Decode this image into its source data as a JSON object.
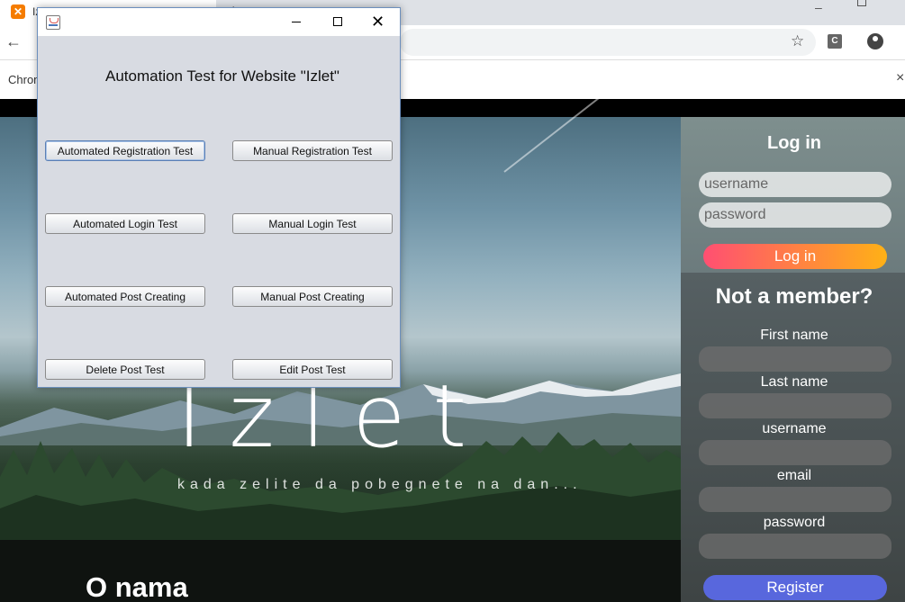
{
  "browser": {
    "tab": {
      "favicon": "xampp-icon",
      "title": "Iz",
      "close": "×"
    },
    "new_tab": "+",
    "window_minimize": "–",
    "toolbar": {
      "back": "←",
      "star": "☆",
      "extension_label": "C",
      "menu": "⋮"
    },
    "infobar": {
      "text": "Chrom",
      "close": "×"
    }
  },
  "site": {
    "brand": "Izlet",
    "tagline": "kada zelite da pobegnete na dan...",
    "about_title": "O nama",
    "login": {
      "title": "Log in",
      "username_placeholder": "username",
      "password_placeholder": "password",
      "button": "Log in"
    },
    "register": {
      "title": "Not a member?",
      "labels": {
        "first_name": "First name",
        "last_name": "Last name",
        "username": "username",
        "email": "email",
        "password": "password"
      },
      "button": "Register"
    },
    "colors": {
      "login_gradient_start": "#ff4f72",
      "login_gradient_end": "#ffb116",
      "register_button": "#5867dd"
    }
  },
  "dialog": {
    "icon": "java-icon",
    "controls": {
      "close": "✕"
    },
    "heading": "Automation Test for Website \"Izlet\"",
    "buttons": {
      "automated_registration": "Automated Registration Test",
      "manual_registration": "Manual Registration Test",
      "automated_login": "Automated Login Test",
      "manual_login": "Manual Login Test",
      "automated_post": "Automated Post Creating",
      "manual_post": "Manual Post Creating",
      "delete_post": "Delete Post Test",
      "edit_post": "Edit Post Test"
    }
  }
}
